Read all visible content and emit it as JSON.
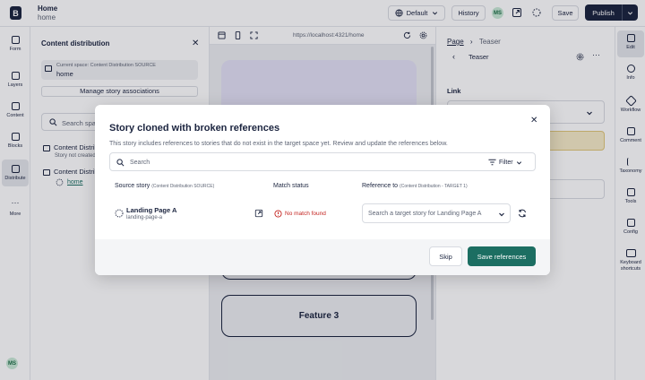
{
  "app": {
    "logo_letter": "B",
    "breadcrumb_title": "Home",
    "breadcrumb_sub": "home",
    "language": "Default",
    "history_label": "History",
    "user_initials": "MS",
    "save_label": "Save",
    "publish_label": "Publish"
  },
  "left_nav": [
    {
      "label": "Form",
      "icon": "form-icon"
    },
    {
      "label": "Layers",
      "icon": "layers-icon"
    },
    {
      "label": "Content",
      "icon": "content-icon"
    },
    {
      "label": "Blocks",
      "icon": "blocks-icon"
    },
    {
      "label": "Distribute",
      "icon": "distribute-icon",
      "active": true
    },
    {
      "label": "More",
      "icon": "more-icon"
    }
  ],
  "content_panel": {
    "title": "Content distribution",
    "space_caption": "Current space: Content Distribution SOURCE",
    "space_name": "home",
    "manage_label": "Manage story associations",
    "search_placeholder": "Search spac",
    "item1_name": "Content Distrib",
    "item1_sub": "Story not created",
    "item2_name": "Content Distrib",
    "item2_link": "home"
  },
  "preview": {
    "url": "https://localhost:4321/home",
    "feature3": "Feature 3"
  },
  "right_panel": {
    "breadcrumb_page": "Page",
    "breadcrumb_current": "Teaser",
    "back_title": "Teaser",
    "link_label": "Link"
  },
  "right_nav": [
    {
      "label": "Edit",
      "icon": "edit-icon",
      "active": true
    },
    {
      "label": "Info",
      "icon": "info-icon"
    },
    {
      "label": "Workflow",
      "icon": "workflow-icon"
    },
    {
      "label": "Comment",
      "icon": "comment-icon"
    },
    {
      "label": "Taxonomy",
      "icon": "taxonomy-icon"
    },
    {
      "label": "Tools",
      "icon": "tools-icon"
    },
    {
      "label": "Config",
      "icon": "config-icon"
    },
    {
      "label": "Keyboard shortcuts",
      "icon": "keyboard-icon"
    }
  ],
  "modal": {
    "title": "Story cloned with broken references",
    "description": "This story includes references to stories that do not exist in the target space yet. Review and update the references below.",
    "search_placeholder": "Search",
    "filter_label": "Filter",
    "col_source": "Source story",
    "col_source_hint": "(Content Distribution SOURCE)",
    "col_match": "Match status",
    "col_reference": "Reference to",
    "col_reference_hint": "(Content Distribution - TARGET 1)",
    "row_name": "Landing Page A",
    "row_slug": "landing-page-a",
    "row_status": "No match found",
    "row_select_placeholder": "Search a target story for Landing Page A",
    "skip_label": "Skip",
    "save_label": "Save references"
  },
  "colors": {
    "primary_dark": "#1b243f",
    "save_green": "#1c6e62",
    "error_red": "#c3231f",
    "warning_bg": "#f6ebc7"
  }
}
